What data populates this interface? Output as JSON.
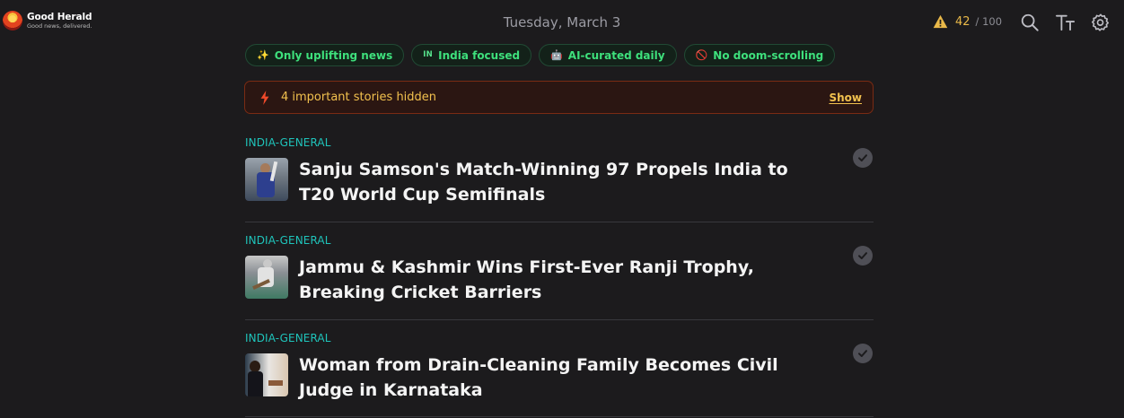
{
  "brand": {
    "name": "Good Herald",
    "tagline": "Good news, delivered."
  },
  "header": {
    "date": "Tuesday, March 3",
    "score_value": "42",
    "score_max": "/ 100"
  },
  "chips": [
    {
      "icon": "sparkles-icon",
      "glyph": "✨",
      "label": "Only uplifting news"
    },
    {
      "icon": "india-flag-icon",
      "glyph": "IN",
      "label": "India focused"
    },
    {
      "icon": "robot-icon",
      "glyph": "🤖",
      "label": "AI-curated daily"
    },
    {
      "icon": "no-entry-icon",
      "glyph": "🚫",
      "label": "No doom-scrolling"
    }
  ],
  "banner": {
    "text": "4 important stories hidden",
    "action": "Show"
  },
  "stories": [
    {
      "category": "INDIA-GENERAL",
      "title": "Sanju Samson's Match-Winning 97 Propels India to T20 World Cup Semifinals"
    },
    {
      "category": "INDIA-GENERAL",
      "title": "Jammu & Kashmir Wins First-Ever Ranji Trophy, Breaking Cricket Barriers"
    },
    {
      "category": "INDIA-GENERAL",
      "title": "Woman from Drain-Cleaning Family Becomes Civil Judge in Karnataka"
    }
  ],
  "colors": {
    "background": "#1c1b1d",
    "chip_text": "#3ee07c",
    "category": "#1fc4bb",
    "warning": "#e9b949",
    "banner_border": "#7a2b13"
  }
}
